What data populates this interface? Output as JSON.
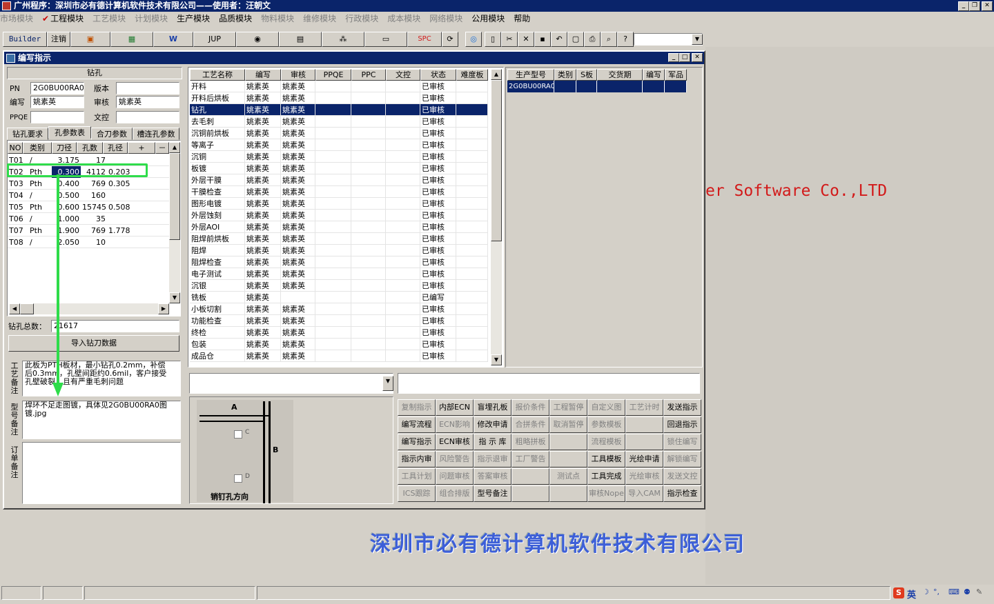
{
  "window": {
    "title": "广州程序：深圳市必有德计算机软件技术有限公司——使用者：汪朝文"
  },
  "menu": [
    {
      "label": "市场模块",
      "enabled": false
    },
    {
      "label": "工程模块",
      "enabled": true,
      "checked": true
    },
    {
      "label": "工艺模块",
      "enabled": false
    },
    {
      "label": "计划模块",
      "enabled": false
    },
    {
      "label": "生产模块",
      "enabled": true
    },
    {
      "label": "品质模块",
      "enabled": true
    },
    {
      "label": "物料模块",
      "enabled": false
    },
    {
      "label": "维修模块",
      "enabled": false
    },
    {
      "label": "行政模块",
      "enabled": false
    },
    {
      "label": "成本模块",
      "enabled": false
    },
    {
      "label": "网络模块",
      "enabled": false
    },
    {
      "label": "公用模块",
      "enabled": true
    },
    {
      "label": "帮助",
      "enabled": true
    }
  ],
  "toolbar": {
    "builder": "Builder",
    "logout": "注销",
    "jup": "JUP",
    "spc": "SPC"
  },
  "child": {
    "title": "编写指示"
  },
  "left": {
    "section": "钻孔",
    "pn_label": "PN",
    "pn_value": "2G0BU00RA0",
    "version_label": "版本",
    "version_value": "",
    "editor_label": "编写",
    "editor_value": "姚素英",
    "reviewer_label": "审核",
    "reviewer_value": "姚素英",
    "ppqe_label": "PPQE",
    "ppqe_value": "",
    "wenkong_label": "文控",
    "wenkong_value": "",
    "tabs": [
      "钻孔要求",
      "孔参数表",
      "合刀参数",
      "槽连孔参数"
    ],
    "active_tab": 1,
    "drill_cols": [
      "NO",
      "类别",
      "刀径",
      "孔数",
      "孔径",
      "+",
      "－"
    ],
    "drill_rows": [
      [
        "T01",
        "/",
        "3.175",
        "17",
        ""
      ],
      [
        "T02",
        "Pth",
        "0.300",
        "4112",
        "0.203"
      ],
      [
        "T03",
        "Pth",
        "0.400",
        "769",
        "0.305"
      ],
      [
        "T04",
        "/",
        "0.500",
        "160",
        ""
      ],
      [
        "T05",
        "Pth",
        "0.600",
        "15745",
        "0.508"
      ],
      [
        "T06",
        "/",
        "1.000",
        "35",
        ""
      ],
      [
        "T07",
        "Pth",
        "1.900",
        "769",
        "1.778"
      ],
      [
        "T08",
        "/",
        "2.050",
        "10",
        ""
      ]
    ],
    "total_label": "钻孔总数：",
    "total_value": "21617",
    "import_button": "导入钻刀数据",
    "note1_label": "工艺备注",
    "note1_text": "此板为PTH板材，最小钻孔0.2mm，补偿后0.3mm，孔壁间距约0.6mil，客户接受孔壁破裂，且有严重毛刺问题",
    "note2_label": "型号备注",
    "note2_text": "焊环不足走图镀，具体见2G0BU00RA0图镀.jpg",
    "note3_label": "订单备注",
    "note3_text": ""
  },
  "process": {
    "cols": [
      "工艺名称",
      "编写",
      "审核",
      "PPQE",
      "PPC",
      "文控",
      "状态",
      "难度板"
    ],
    "rows": [
      [
        "开料",
        "姚素英",
        "姚素英",
        "已审核"
      ],
      [
        "开料后烘板",
        "姚素英",
        "姚素英",
        "已审核"
      ],
      [
        "钻孔",
        "姚素英",
        "姚素英",
        "已审核"
      ],
      [
        "去毛刺",
        "姚素英",
        "姚素英",
        "已审核"
      ],
      [
        "沉铜前烘板",
        "姚素英",
        "姚素英",
        "已审核"
      ],
      [
        "等离子",
        "姚素英",
        "姚素英",
        "已审核"
      ],
      [
        "沉铜",
        "姚素英",
        "姚素英",
        "已审核"
      ],
      [
        "板镀",
        "姚素英",
        "姚素英",
        "已审核"
      ],
      [
        "外层干膜",
        "姚素英",
        "姚素英",
        "已审核"
      ],
      [
        "干膜检查",
        "姚素英",
        "姚素英",
        "已审核"
      ],
      [
        "图形电镀",
        "姚素英",
        "姚素英",
        "已审核"
      ],
      [
        "外层蚀刻",
        "姚素英",
        "姚素英",
        "已审核"
      ],
      [
        "外层AOI",
        "姚素英",
        "姚素英",
        "已审核"
      ],
      [
        "阻焊前烘板",
        "姚素英",
        "姚素英",
        "已审核"
      ],
      [
        "阻焊",
        "姚素英",
        "姚素英",
        "已审核"
      ],
      [
        "阻焊检查",
        "姚素英",
        "姚素英",
        "已审核"
      ],
      [
        "电子测试",
        "姚素英",
        "姚素英",
        "已审核"
      ],
      [
        "沉银",
        "姚素英",
        "姚素英",
        "已审核"
      ],
      [
        "铣板",
        "姚素英",
        "",
        "已编写"
      ],
      [
        "小板切割",
        "姚素英",
        "姚素英",
        "已审核"
      ],
      [
        "功能检查",
        "姚素英",
        "姚素英",
        "已审核"
      ],
      [
        "终检",
        "姚素英",
        "姚素英",
        "已审核"
      ],
      [
        "包装",
        "姚素英",
        "姚素英",
        "已审核"
      ],
      [
        "成品仓",
        "姚素英",
        "姚素英",
        "已审核"
      ]
    ],
    "selected": 2
  },
  "orders": {
    "cols": [
      "生产型号",
      "类别",
      "S板",
      "交货期",
      "编写",
      "军品"
    ],
    "rows": [
      [
        "2G0BU00RA0",
        "",
        "",
        "",
        "",
        ""
      ]
    ]
  },
  "diagram": {
    "a": "A",
    "b": "B",
    "c": "C",
    "d": "D",
    "caption": "销钉孔方向"
  },
  "buttons": [
    [
      "复制指示",
      "内部ECN",
      "盲埋孔板",
      "报价条件",
      "工程暂停",
      "自定义图",
      "工艺计时",
      "发送指示"
    ],
    [
      "编写流程",
      "ECN影响",
      "修改申请",
      "合拼条件",
      "取消暂停",
      "参数模板",
      "",
      "回退指示"
    ],
    [
      "编写指示",
      "ECN审核",
      "指 示 库",
      "粗略拼板",
      "",
      "流程模板",
      "",
      "锁住编写"
    ],
    [
      "指示内审",
      "风险警告",
      "指示退审",
      "工厂警告",
      "",
      "工具模板",
      "光绘申请",
      "解锁编写"
    ],
    [
      "工具计划",
      "问题审核",
      "答案审核",
      "",
      "测试点",
      "工具完成",
      "光绘审核",
      "发送文控"
    ],
    [
      "ICS跟踪",
      "组合排版",
      "型号备注",
      "",
      "",
      "审核Nope",
      "导入CAM",
      "指示检查"
    ]
  ],
  "buttons_enabled": [
    [
      false,
      true,
      true,
      false,
      false,
      false,
      false,
      true
    ],
    [
      true,
      false,
      true,
      false,
      false,
      false,
      false,
      true
    ],
    [
      true,
      true,
      true,
      false,
      false,
      false,
      false,
      false
    ],
    [
      true,
      false,
      false,
      false,
      false,
      true,
      true,
      false
    ],
    [
      false,
      false,
      false,
      false,
      false,
      true,
      false,
      false
    ],
    [
      false,
      false,
      true,
      false,
      false,
      false,
      false,
      true
    ]
  ],
  "brand": {
    "en": "er Software Co.,LTD",
    "cn": "深圳市必有德计算机软件技术有限公司"
  },
  "tray": {
    "ime": "英"
  }
}
